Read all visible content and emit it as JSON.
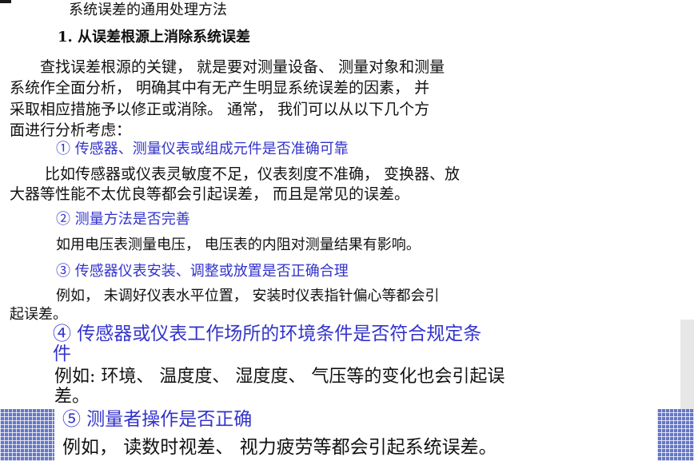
{
  "title": "系统误差的通用处理方法",
  "section1": "1. 从误差根源上消除系统误差",
  "intro_lines": [
    "查找误差根源的关键，  就是要对测量设备、 测量对象和测量",
    "系统作全面分析， 明确其中有无产生明显系统误差的因素， 并",
    "采取相应措施予以修正或消除。 通常， 我们可以从以下几个方",
    "面进行分析考虑："
  ],
  "items": [
    {
      "heading": "① 传感器、测量仪表或组成元件是否准确可靠",
      "lines": [
        "比如传感器或仪表灵敏度不足，仪表刻度不准确， 变换器、放",
        "大器等性能不太优良等都会引起误差，  而且是常见的误差。"
      ]
    },
    {
      "heading": "② 测量方法是否完善",
      "lines": [
        "如用电压表测量电压，  电压表的内阻对测量结果有影响。"
      ]
    },
    {
      "heading": "③ 传感器仪表安装、调整或放置是否正确合理",
      "lines": [
        "例如， 未调好仪表水平位置， 安装时仪表指针偏心等都会引",
        "起误差。"
      ]
    },
    {
      "heading": "④ 传感器或仪表工作场所的环境条件是否符合规定条",
      "heading_cont": "件",
      "lines": [
        "例如: 环境、 温度度、  湿度度、 气压等的变化也会引起误",
        "差。"
      ]
    },
    {
      "heading": "⑤ 测量者操作是否正确",
      "lines": [
        "例如，  读数时视差、 视力疲劳等都会引起系统误差。"
      ]
    }
  ],
  "colors": {
    "accent_blue": "#3333cc",
    "grid_blue": "#6677c4",
    "text": "#111111"
  }
}
